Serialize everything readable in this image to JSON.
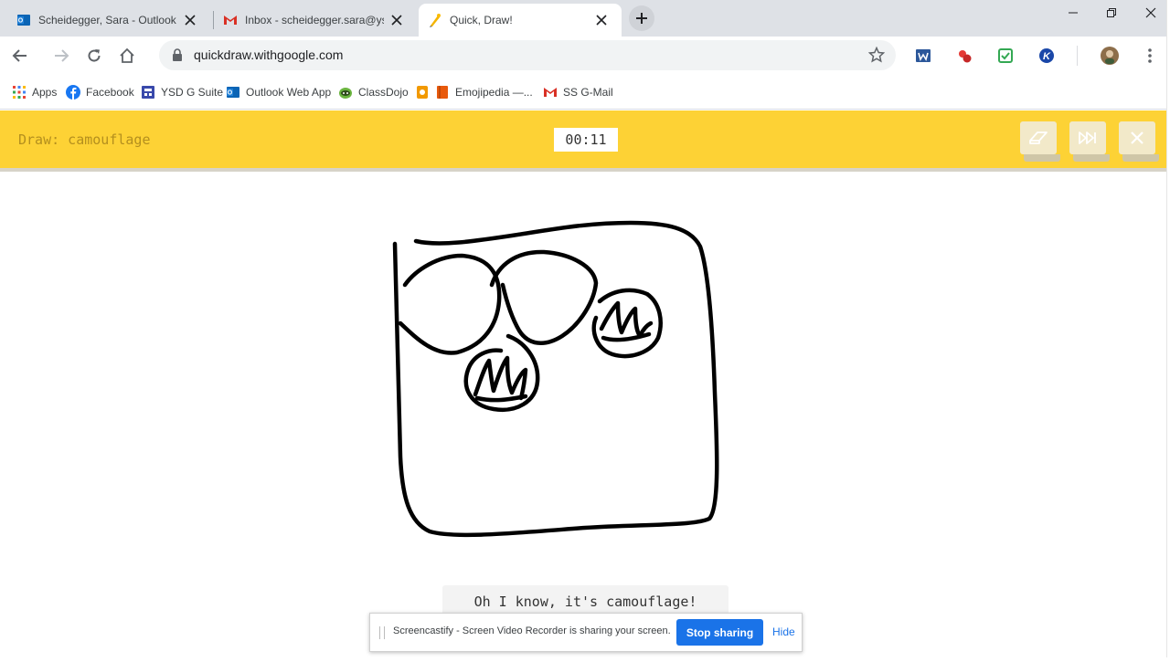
{
  "browser": {
    "tabs": [
      {
        "title": "Scheidegger, Sara - Outlook W",
        "icon": "outlook-icon"
      },
      {
        "title": "Inbox - scheidegger.sara@ysd",
        "icon": "gmail-icon"
      },
      {
        "title": "Quick, Draw!",
        "icon": "quickdraw-icon",
        "active": true
      }
    ],
    "url": "quickdraw.withgoogle.com"
  },
  "bookmarks": [
    {
      "label": "Apps",
      "icon": "apps-grid-icon"
    },
    {
      "label": "Facebook",
      "icon": "facebook-icon"
    },
    {
      "label": "YSD G Suite",
      "icon": "gsuite-icon"
    },
    {
      "label": "Outlook Web App",
      "icon": "outlook-icon"
    },
    {
      "label": "ClassDojo",
      "icon": "classdojo-icon"
    },
    {
      "label": "",
      "icon": "bookmark-icon"
    },
    {
      "label": "Emojipedia —...",
      "icon": "emojipedia-icon"
    },
    {
      "label": "SS G-Mail",
      "icon": "gmail-icon"
    }
  ],
  "game": {
    "prompt": "Draw: camouflage",
    "timer": "00:11",
    "guess": "Oh I know, it's camouflage!",
    "header_color": "#fdd235"
  },
  "share_bar": {
    "message": "Screencastify - Screen Video Recorder is sharing your screen.",
    "stop_label": "Stop sharing",
    "hide_label": "Hide"
  }
}
